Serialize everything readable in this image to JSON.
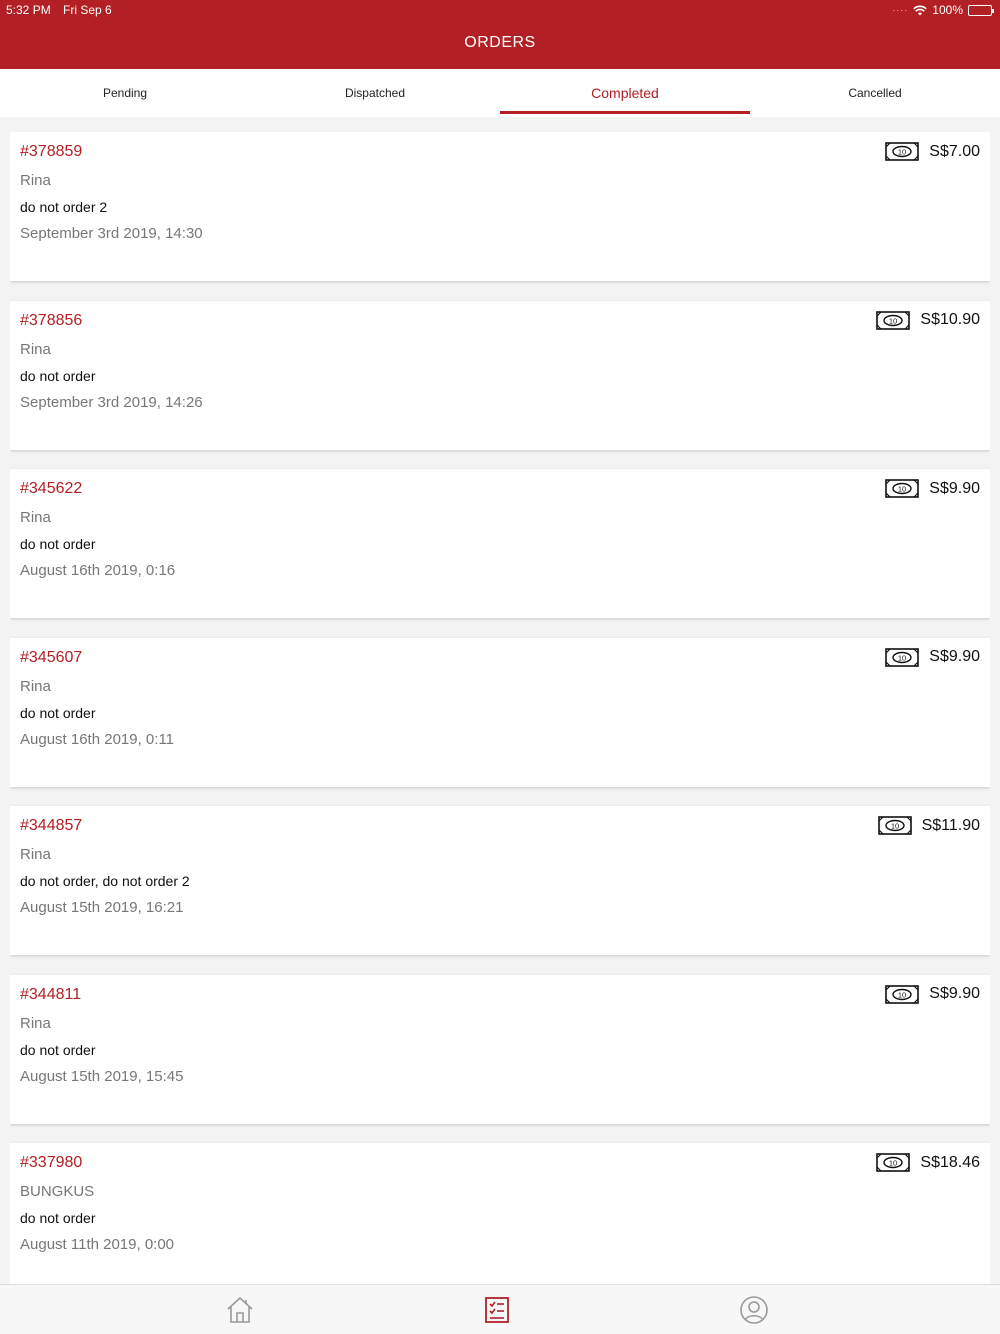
{
  "status_bar": {
    "time": "5:32 PM",
    "date": "Fri Sep 6",
    "battery": "100%"
  },
  "header": {
    "title": "ORDERS"
  },
  "tabs": [
    {
      "label": "Pending"
    },
    {
      "label": "Dispatched"
    },
    {
      "label": "Completed"
    },
    {
      "label": "Cancelled"
    }
  ],
  "active_tab": "Completed",
  "orders": [
    {
      "id": "#378859",
      "customer": "Rina",
      "items": "do not order 2",
      "date": "September 3rd 2019, 14:30",
      "price": "S$7.00"
    },
    {
      "id": "#378856",
      "customer": "Rina",
      "items": "do not order",
      "date": "September 3rd 2019, 14:26",
      "price": "S$10.90"
    },
    {
      "id": "#345622",
      "customer": "Rina",
      "items": "do not order",
      "date": "August 16th 2019, 0:16",
      "price": "S$9.90"
    },
    {
      "id": "#345607",
      "customer": "Rina",
      "items": "do not order",
      "date": "August 16th 2019, 0:11",
      "price": "S$9.90"
    },
    {
      "id": "#344857",
      "customer": "Rina",
      "items": "do not order, do not order 2",
      "date": "August 15th 2019, 16:21",
      "price": "S$11.90"
    },
    {
      "id": "#344811",
      "customer": "Rina",
      "items": "do not order",
      "date": "August 15th 2019, 15:45",
      "price": "S$9.90"
    },
    {
      "id": "#337980",
      "customer": "BUNGKUS",
      "items": "do not order",
      "date": "August 11th 2019, 0:00",
      "price": "S$18.46"
    }
  ],
  "payment_icon": {
    "name": "cash-icon",
    "label": "10"
  },
  "bottom_nav": [
    {
      "name": "home-icon"
    },
    {
      "name": "orders-list-icon"
    },
    {
      "name": "profile-icon"
    }
  ],
  "colors": {
    "brand": "#b22025",
    "background": "#f3f3f3",
    "secondary_text": "#777777"
  }
}
